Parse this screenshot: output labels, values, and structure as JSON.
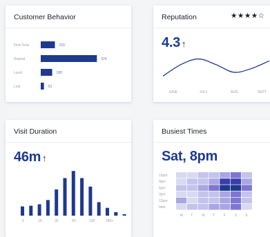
{
  "cards": {
    "customer_behavior": {
      "title": "Customer Behavior"
    },
    "reputation": {
      "title": "Reputation",
      "stars_icon": "rating-stars-icon",
      "rating": "4.3",
      "trend_arrow": "↑"
    },
    "visit_duration": {
      "title": "Visit Duration",
      "value": "46m",
      "trend_arrow": "↑"
    },
    "busiest_times": {
      "title": "Busiest Times",
      "value": "Sat, 8pm"
    }
  },
  "rating_stars": {
    "filled": 4,
    "total": 5,
    "text": "★★★★☆"
  },
  "colors": {
    "primary": "#1d3a8e",
    "accent": "#5a4fcf"
  },
  "chart_data": [
    {
      "id": "customer_behavior",
      "type": "bar",
      "orientation": "horizontal",
      "categories": [
        "First-Time",
        "Repeat",
        "Local",
        "Lost"
      ],
      "values": [
        233,
        924,
        188,
        53
      ],
      "xlim": [
        0,
        1000
      ]
    },
    {
      "id": "reputation",
      "type": "line",
      "x": [
        "JUNE",
        "JULY",
        "AUG",
        "SEPT"
      ],
      "series": [
        {
          "values": [
            3.7,
            4.3,
            4.6,
            4.3,
            3.9,
            4.1,
            4.5
          ]
        }
      ],
      "ylim": [
        3.5,
        4.8
      ]
    },
    {
      "id": "visit_duration",
      "type": "bar",
      "x_ticks": [
        "5",
        "15",
        "30",
        "60",
        "120",
        "180+"
      ],
      "values": [
        13,
        14,
        16,
        22,
        37,
        53,
        63,
        53,
        41,
        19,
        11,
        5,
        2
      ],
      "ylim": [
        0,
        70
      ]
    },
    {
      "id": "busiest_times",
      "type": "heatmap",
      "columns": [
        "M",
        "T",
        "W",
        "T",
        "F",
        "S",
        "S"
      ],
      "rows": [
        "12pm",
        "9pm",
        "6pm",
        "3pm",
        "12pm",
        "9am"
      ],
      "values": [
        [
          1,
          1,
          2,
          2,
          3,
          4,
          2
        ],
        [
          1,
          2,
          2,
          3,
          5,
          5,
          3
        ],
        [
          2,
          2,
          3,
          4,
          6,
          6,
          4
        ],
        [
          1,
          1,
          2,
          2,
          3,
          4,
          2
        ],
        [
          3,
          1,
          2,
          2,
          3,
          4,
          2
        ],
        [
          1,
          2,
          2,
          3,
          3,
          4,
          1
        ]
      ]
    }
  ]
}
